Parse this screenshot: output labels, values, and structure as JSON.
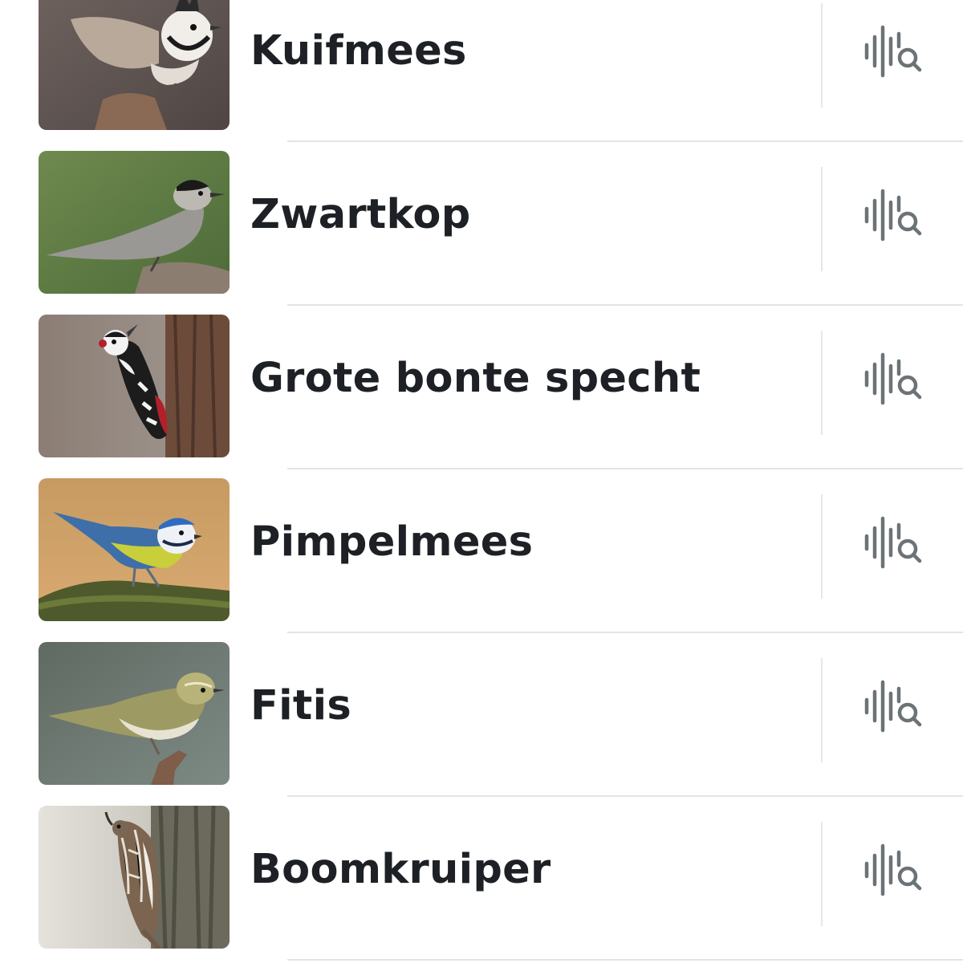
{
  "birds": [
    {
      "name": "Kuifmees",
      "photo_icon": "crested-tit-photo",
      "action_icon": "sound-search-icon"
    },
    {
      "name": "Zwartkop",
      "photo_icon": "blackcap-photo",
      "action_icon": "sound-search-icon"
    },
    {
      "name": "Grote bonte specht",
      "photo_icon": "great-spotted-woodpecker-photo",
      "action_icon": "sound-search-icon"
    },
    {
      "name": "Pimpelmees",
      "photo_icon": "blue-tit-photo",
      "action_icon": "sound-search-icon"
    },
    {
      "name": "Fitis",
      "photo_icon": "willow-warbler-photo",
      "action_icon": "sound-search-icon"
    },
    {
      "name": "Boomkruiper",
      "photo_icon": "treecreeper-photo",
      "action_icon": "sound-search-icon"
    }
  ],
  "colors": {
    "text": "#1d2125",
    "icon": "#6b7377",
    "divider": "#e4e4e4"
  }
}
